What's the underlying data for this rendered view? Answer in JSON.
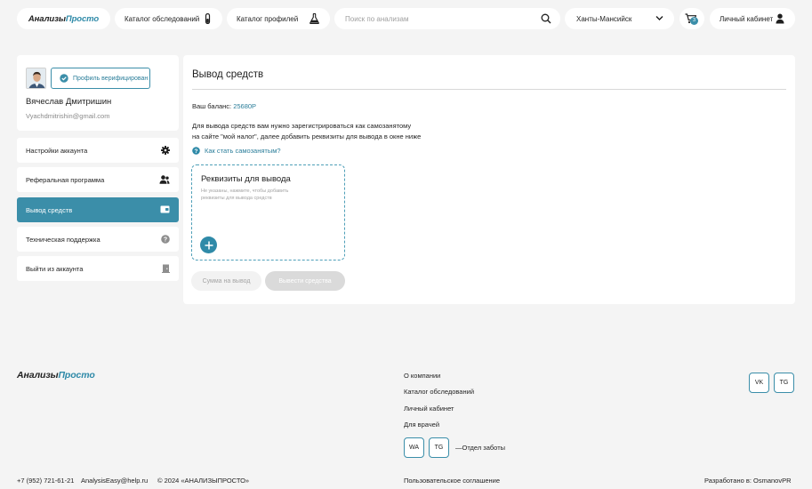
{
  "header": {
    "logo": {
      "part1": "Анализы",
      "part2": "Просто"
    },
    "catalog_tests": "Каталог обследований",
    "catalog_profiles": "Каталог профилей",
    "search_placeholder": "Поиск по анализам",
    "city": "Ханты-Мансийск",
    "cart_count": "3",
    "cabinet": "Личный кабинет"
  },
  "profile": {
    "verified_label": "Профиль верифицирован",
    "name": "Вячеслав Дмитришин",
    "email": "Vyachdmitrishin@gmail.com"
  },
  "sidebar": {
    "items": [
      {
        "label": "Настройки аккаунта",
        "icon": "gear-icon"
      },
      {
        "label": "Реферальная программа",
        "icon": "users-icon"
      },
      {
        "label": "Вывод средств",
        "icon": "wallet-icon"
      },
      {
        "label": "Техническая поддержка",
        "icon": "question-icon"
      },
      {
        "label": "Выйти из аккаунта",
        "icon": "door-icon"
      }
    ]
  },
  "main": {
    "title": "Вывод средств",
    "balance_label": "Ваш баланс:",
    "balance_value": "25680Р",
    "info_line1": "Для вывода средств вам нужно зарегистрироваться как самозанятому",
    "info_line2": "на сайте \"мой налог\", далее добавить реквизиты для вывода в окне ниже",
    "howto": "Как стать самозанятым?",
    "requisites_title": "Реквизиты для вывода",
    "requisites_hint": "Не указаны, нажмите, чтобы добавить реквизиты для вывода средств",
    "amount_placeholder": "Сумма на вывод",
    "withdraw_button": "Вывести средства"
  },
  "footer": {
    "logo": {
      "part1": "Анализы",
      "part2": "Просто"
    },
    "links": [
      "О компании",
      "Каталог обследований",
      "Личный кабинет",
      "Для врачей"
    ],
    "social": {
      "wa": "WA",
      "tg": "TG",
      "vk": "VK"
    },
    "care": "—Отдел заботы",
    "phone": "+7 (952) 721-61-21",
    "email": "AnalysisEasy@help.ru",
    "copyright": "© 2024 «АНАЛИЗЫПРОСТО»",
    "agreement": "Пользовательское соглашение",
    "developer": "Разработано в: OsmanovPR"
  },
  "colors": {
    "accent": "#3b8ea9",
    "background": "#f4f4f4",
    "card": "#ffffff"
  }
}
